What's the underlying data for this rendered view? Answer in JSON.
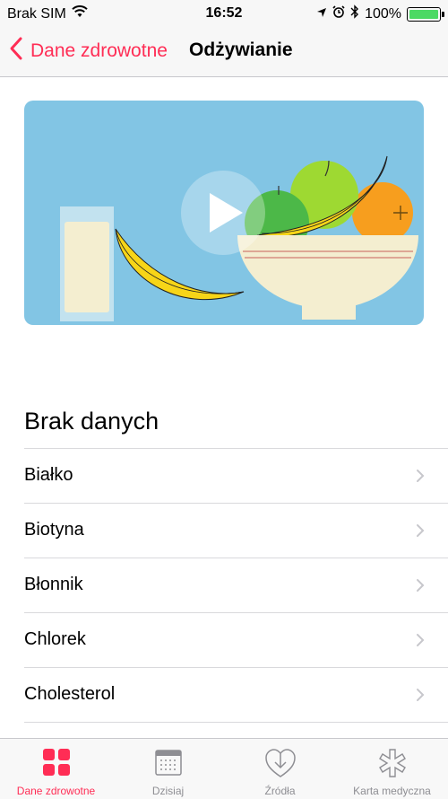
{
  "status_bar": {
    "carrier": "Brak SIM",
    "time": "16:52",
    "battery": "100%"
  },
  "nav": {
    "back_label": "Dane zdrowotne",
    "title": "Odżywianie"
  },
  "section_title": "Brak danych",
  "items": [
    {
      "label": "Białko"
    },
    {
      "label": "Biotyna"
    },
    {
      "label": "Błonnik"
    },
    {
      "label": "Chlorek"
    },
    {
      "label": "Cholesterol"
    }
  ],
  "tabs": [
    {
      "label": "Dane zdrowotne",
      "icon": "grid-icon",
      "active": true
    },
    {
      "label": "Dzisiaj",
      "icon": "calendar-icon",
      "active": false
    },
    {
      "label": "Źródła",
      "icon": "download-heart-icon",
      "active": false
    },
    {
      "label": "Karta medyczna",
      "icon": "asterisk-icon",
      "active": false
    }
  ],
  "colors": {
    "accent": "#ff2d55",
    "hero_background": "#82c5e4",
    "battery": "#4cd964"
  }
}
